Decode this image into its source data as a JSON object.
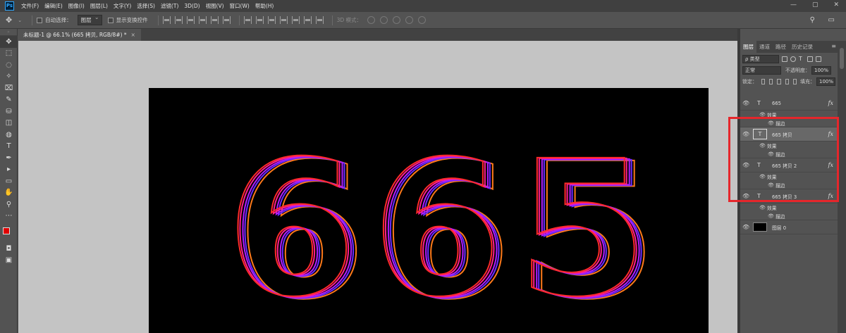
{
  "menubar": {
    "logo": "Ps",
    "items": [
      "文件(F)",
      "编辑(E)",
      "图像(I)",
      "图层(L)",
      "文字(Y)",
      "选择(S)",
      "滤镜(T)",
      "3D(D)",
      "视图(V)",
      "窗口(W)",
      "帮助(H)"
    ],
    "controls": [
      "—",
      "▢",
      "✕"
    ]
  },
  "options": {
    "auto_select_label": "自动选择：",
    "auto_select_value": "图层",
    "show_transform_label": "显示变换控件",
    "mode_3d_label": "3D 模式："
  },
  "document": {
    "tab_title": "未标题-1 @ 66.1% (665 拷贝, RGB/8#) *",
    "close": "×",
    "artwork_text": "665"
  },
  "tools": [
    "✥",
    "⬚",
    "◌",
    "✧",
    "⌧",
    "✎",
    "⛁",
    "◫",
    "◍",
    "T",
    "✒",
    "▸",
    "▭",
    "✋",
    "⚲",
    "⋯"
  ],
  "colors": {
    "foreground": "#e00000",
    "background": "#000000"
  },
  "layers_panel": {
    "tabs": [
      "图层",
      "通道",
      "路径",
      "历史记录"
    ],
    "filter_kind": "ρ 类型",
    "blend_mode": "正常",
    "opacity_label": "不透明度：",
    "opacity_value": "100%",
    "lock_label": "锁定：",
    "fill_label": "填充：",
    "fill_value": "100%",
    "layers": [
      {
        "name": "665",
        "effects_label": "效果",
        "stroke_label": "描边",
        "fx": "fx"
      },
      {
        "name": "665 拷贝",
        "effects_label": "效果",
        "stroke_label": "描边",
        "fx": "fx"
      },
      {
        "name": "665 拷贝 2",
        "effects_label": "效果",
        "stroke_label": "描边",
        "fx": "fx"
      },
      {
        "name": "665 拷贝 3",
        "effects_label": "效果",
        "stroke_label": "描边",
        "fx": "fx"
      }
    ],
    "background_layer": "图层 0"
  }
}
